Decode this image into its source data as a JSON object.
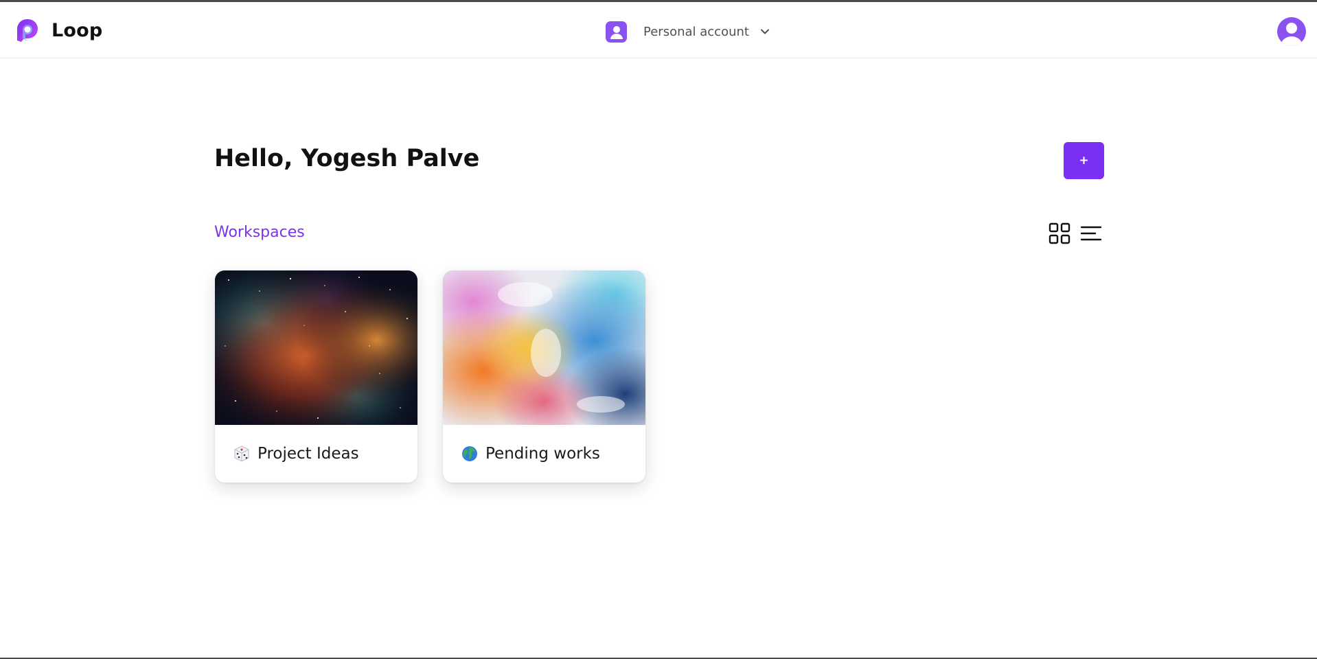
{
  "header": {
    "brand_name": "Loop",
    "account_label": "Personal account",
    "logo_icon": "loop-logo-icon",
    "avatar_icon": "user-avatar-icon",
    "chevron_icon": "chevron-down-icon"
  },
  "main": {
    "greeting": "Hello, Yogesh Palve",
    "add_label": "+",
    "section_title": "Workspaces",
    "view_icons": [
      "grid-view-icon",
      "list-view-icon"
    ]
  },
  "workspaces": [
    {
      "emoji_icon": "dice-icon",
      "title": "Project Ideas",
      "cover": "nebula"
    },
    {
      "emoji_icon": "globe-icon",
      "title": "Pending works",
      "cover": "paint-smoke"
    }
  ],
  "colors": {
    "accent": "#7b2ff2",
    "section_title": "#7a33ea",
    "avatar": "#8a52f0",
    "text": "#111111",
    "muted_text": "#4f4f5b"
  }
}
